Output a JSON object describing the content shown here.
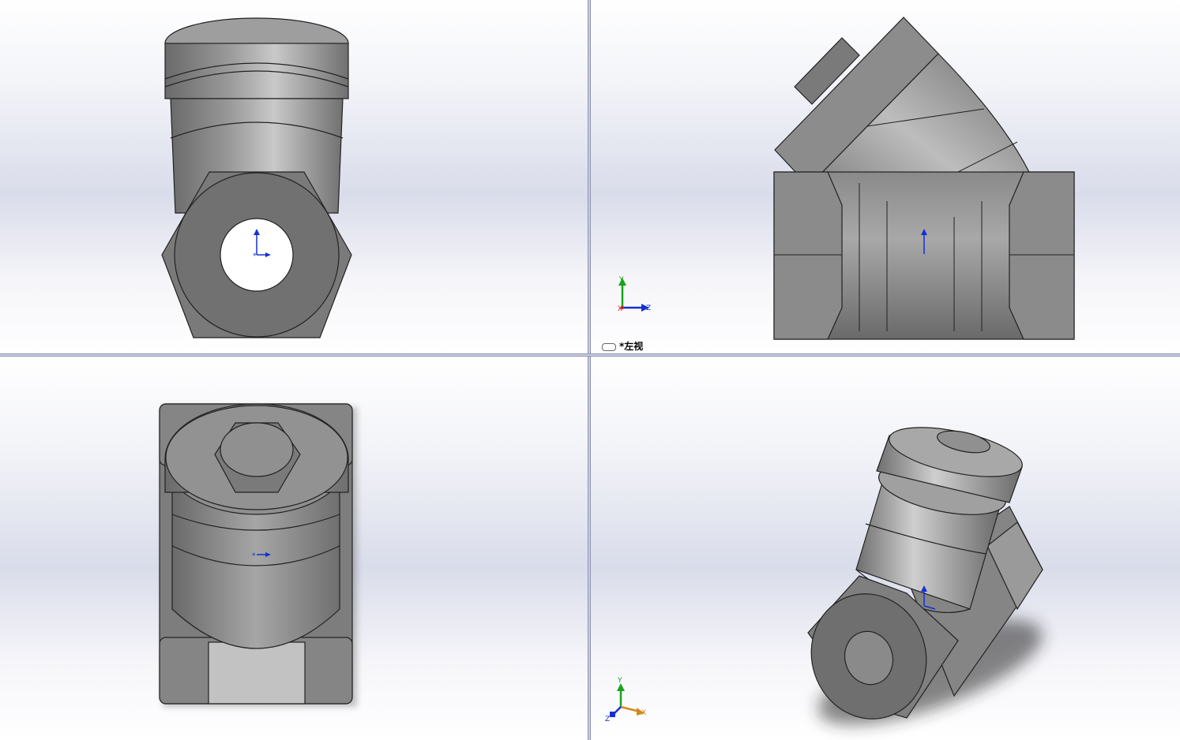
{
  "viewports": {
    "top_right": {
      "view_name": "*左视",
      "triad": {
        "y": "Y",
        "x": "X",
        "z": "Z"
      }
    },
    "bottom_right": {
      "triad": {
        "y": "Y",
        "x": "X",
        "z": "Z"
      }
    }
  },
  "colors": {
    "part_dark": "#6f6f6f",
    "part_mid": "#8c8c8c",
    "part_light": "#b4b4b4",
    "axis_y": "#1aa31a",
    "axis_z": "#1530d0",
    "axis_x": "#d01a1a"
  },
  "icons": [
    "link-icon",
    "triad-icon",
    "origin-marker-icon"
  ]
}
